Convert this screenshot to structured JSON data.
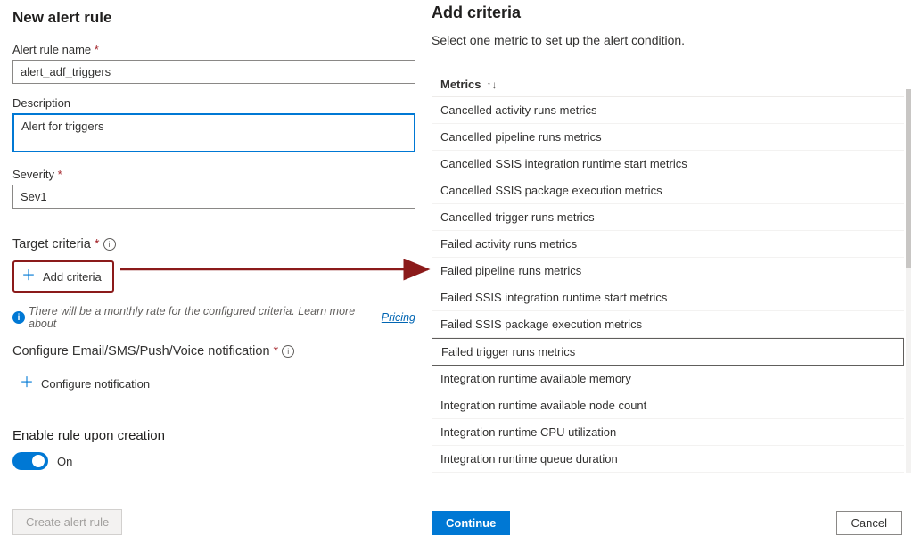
{
  "left": {
    "title": "New alert rule",
    "name_label": "Alert rule name",
    "name_value": "alert_adf_triggers",
    "desc_label": "Description",
    "desc_value": "Alert for triggers",
    "severity_label": "Severity",
    "severity_value": "Sev1",
    "target_label": "Target criteria",
    "add_criteria": "Add criteria",
    "info_text": "There will be a monthly rate for the configured criteria. Learn more about ",
    "pricing_link": "Pricing",
    "notify_label": "Configure Email/SMS/Push/Voice notification",
    "configure_notification": "Configure notification",
    "enable_label": "Enable rule upon creation",
    "toggle_label": "On",
    "create_btn": "Create alert rule"
  },
  "right": {
    "title": "Add criteria",
    "subtitle": "Select one metric to set up the alert condition.",
    "metrics_header": "Metrics",
    "metrics": [
      "Cancelled activity runs metrics",
      "Cancelled pipeline runs metrics",
      "Cancelled SSIS integration runtime start metrics",
      "Cancelled SSIS package execution metrics",
      "Cancelled trigger runs metrics",
      "Failed activity runs metrics",
      "Failed pipeline runs metrics",
      "Failed SSIS integration runtime start metrics",
      "Failed SSIS package execution metrics",
      "Failed trigger runs metrics",
      "Integration runtime available memory",
      "Integration runtime available node count",
      "Integration runtime CPU utilization",
      "Integration runtime queue duration"
    ],
    "selected_index": 9,
    "continue_btn": "Continue",
    "cancel_btn": "Cancel"
  }
}
